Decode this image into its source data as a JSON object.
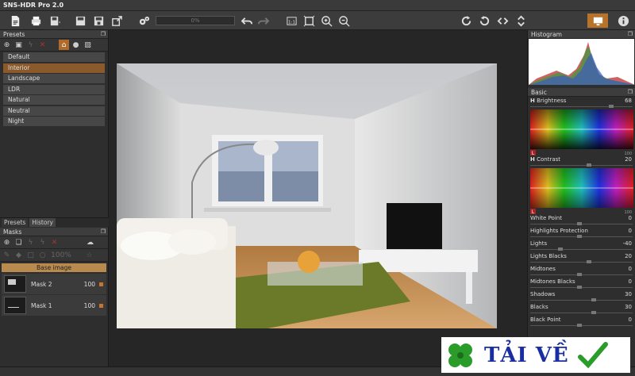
{
  "app": {
    "title": "SNS-HDR Pro 2.0"
  },
  "toolbar": {
    "progress_text": "0%"
  },
  "presets": {
    "title": "Presets",
    "items": [
      "Default",
      "Interior",
      "Landscape",
      "LDR",
      "Natural",
      "Neutral",
      "Night"
    ],
    "selected": "Interior"
  },
  "tabs": [
    "Presets",
    "History"
  ],
  "masks": {
    "title": "Masks",
    "zoom": "100%",
    "base_label": "Base image",
    "items": [
      {
        "name": "Mask 2",
        "value": "100"
      },
      {
        "name": "Mask 1",
        "value": "100"
      }
    ]
  },
  "histogram": {
    "title": "Histogram"
  },
  "basic": {
    "title": "Basic",
    "brightness": {
      "label": "Brightness",
      "value": "68",
      "prefix": "H",
      "level": 0.84
    },
    "contrast": {
      "label": "Contrast",
      "value": "20",
      "prefix": "H",
      "level": 0.6
    },
    "spectrum_marker": "L",
    "spectrum_scale": "100",
    "sliders": [
      {
        "label": "White Point",
        "value": "0",
        "level": 0.5
      },
      {
        "label": "Highlights Protection",
        "value": "0",
        "level": 0.5
      },
      {
        "label": "Lights",
        "value": "-40",
        "level": 0.3
      },
      {
        "label": "Lights Blacks",
        "value": "20",
        "level": 0.6
      },
      {
        "label": "Midtones",
        "value": "0",
        "level": 0.5
      },
      {
        "label": "Midtones Blacks",
        "value": "0",
        "level": 0.5
      },
      {
        "label": "Shadows",
        "value": "30",
        "level": 0.65
      },
      {
        "label": "Blacks",
        "value": "30",
        "level": 0.65
      },
      {
        "label": "Black Point",
        "value": "0",
        "level": 0.5
      }
    ]
  },
  "watermark": {
    "text": "TẢI VỀ"
  }
}
